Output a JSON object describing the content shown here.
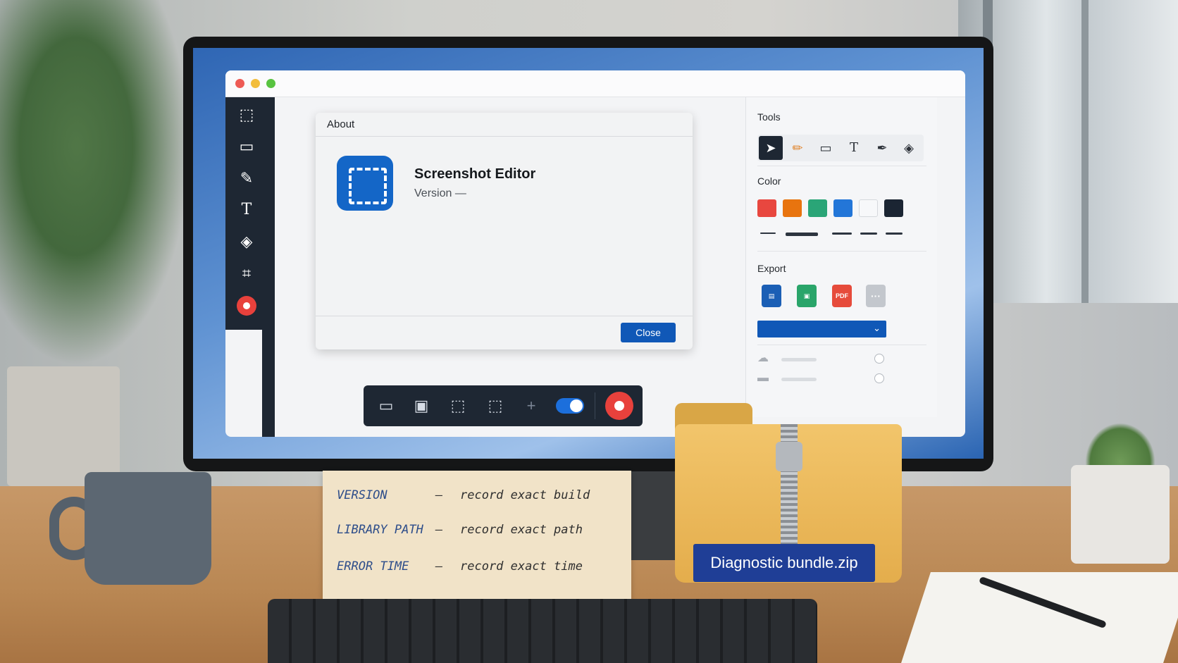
{
  "left_toolbar": {
    "items": [
      {
        "icon": "selection-icon",
        "glyph": "⬚"
      },
      {
        "icon": "comment-icon",
        "glyph": "▭"
      },
      {
        "icon": "pen-icon",
        "glyph": "✎"
      },
      {
        "icon": "text-icon",
        "glyph": "T"
      },
      {
        "icon": "blur-icon",
        "glyph": "◈"
      },
      {
        "icon": "crop-icon",
        "glyph": "⌗"
      }
    ],
    "record_icon": "record-icon"
  },
  "about_dialog": {
    "header": "About",
    "app_name": "Screenshot Editor",
    "version_text": "Version —",
    "close_label": "Close",
    "icon": "app-logo-icon",
    "icon_color": "#1466c7"
  },
  "right_panel": {
    "tools_label": "Tools",
    "tools": [
      {
        "icon": "cursor-icon",
        "glyph": "➤",
        "active": true
      },
      {
        "icon": "pencil-icon",
        "glyph": "✏",
        "active": false
      },
      {
        "icon": "comment-icon",
        "glyph": "▭",
        "active": false
      },
      {
        "icon": "text-icon",
        "glyph": "T",
        "active": false
      },
      {
        "icon": "marker-icon",
        "glyph": "✒",
        "active": false
      },
      {
        "icon": "blur-icon",
        "glyph": "◈",
        "active": false
      }
    ],
    "color_label": "Color",
    "colors": [
      "#e8473f",
      "#e8740f",
      "#2aa577",
      "#2376d8",
      "#f7f8fa",
      "#1b2533"
    ],
    "export_label": "Export",
    "export_icons": [
      {
        "icon": "doc-export-icon",
        "color": "#1b5fb5"
      },
      {
        "icon": "sheet-export-icon",
        "color": "#2aa56a"
      },
      {
        "icon": "pdf-export-icon",
        "color": "#e64b3b",
        "text": "PDF"
      },
      {
        "icon": "more-icon",
        "color": "#c3c7cd",
        "text": "···"
      }
    ],
    "storage": [
      {
        "icon": "cloud-icon",
        "glyph": "☁"
      },
      {
        "icon": "folder-icon",
        "glyph": "▬"
      }
    ]
  },
  "capture_bar": {
    "icons": [
      "monitor-icon",
      "window-icon",
      "region-icon",
      "region-dashed-icon",
      "plus-icon"
    ],
    "toggle_on": true,
    "accent": "#1c6fdc"
  },
  "note_card": {
    "rows": [
      {
        "key": "VERSION",
        "dash": "—",
        "value": "record exact build"
      },
      {
        "key": "LIBRARY PATH",
        "dash": "—",
        "value": "record exact path"
      },
      {
        "key": "ERROR TIME",
        "dash": "—",
        "value": "record exact time"
      }
    ]
  },
  "folder": {
    "label": "Diagnostic bundle.zip"
  }
}
